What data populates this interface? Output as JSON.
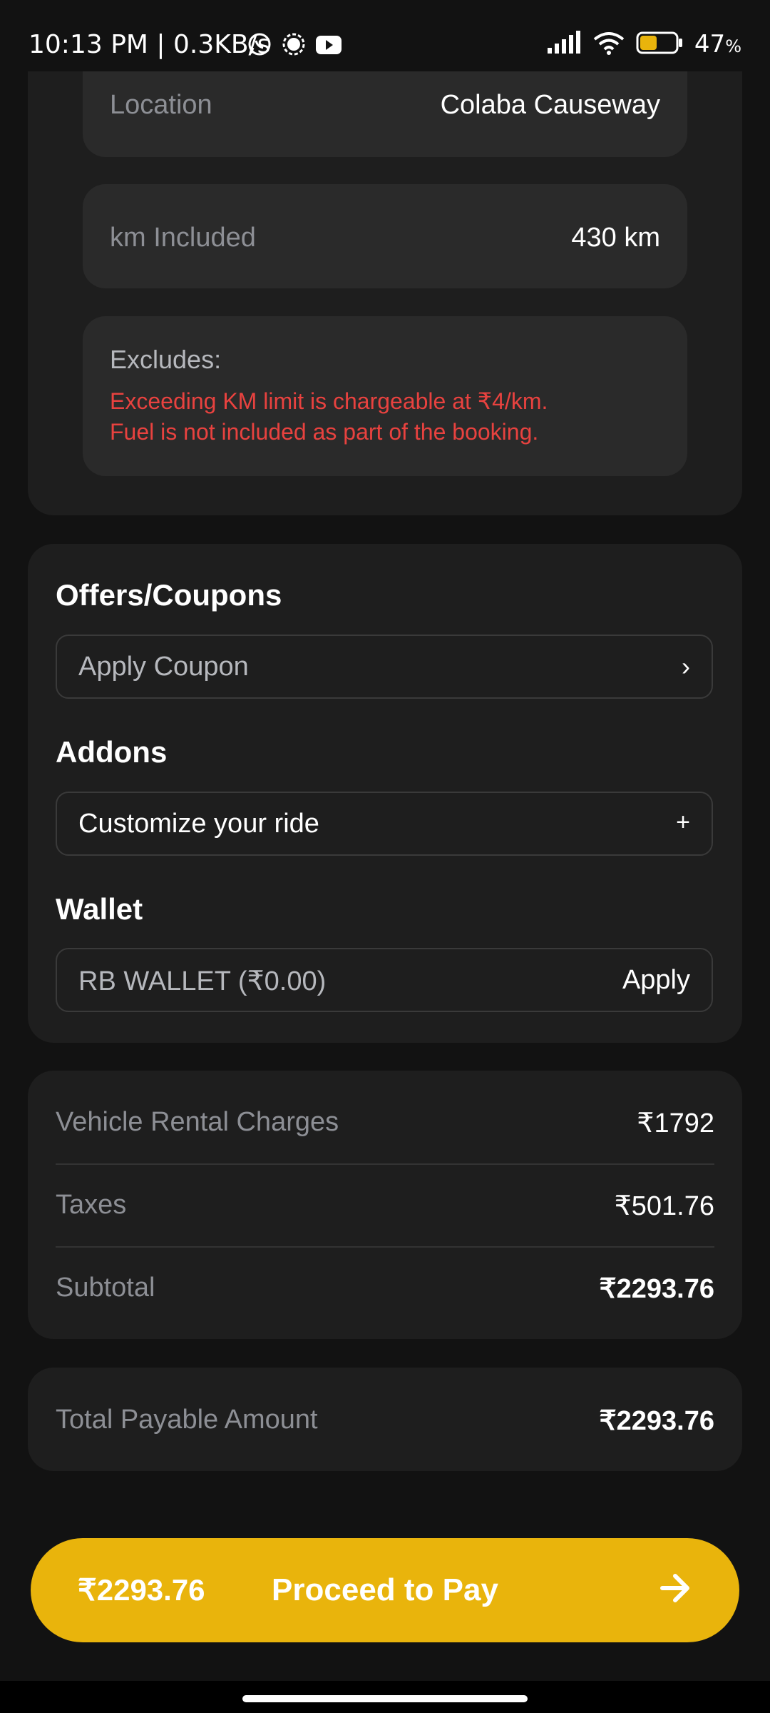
{
  "status_bar": {
    "time_speed": "10:13 PM | 0.3KB/s",
    "battery_percent": "47",
    "battery_unit": "%",
    "battery_level": 0.47,
    "icons": [
      "whatsapp-icon",
      "signal-app-icon",
      "youtube-icon",
      "cellular-signal-icon",
      "wifi-icon",
      "battery-icon"
    ]
  },
  "booking": {
    "location_label": "Location",
    "location_value": "Colaba Causeway",
    "km_label": "km Included",
    "km_value": "430 km",
    "excludes_title": "Excludes:",
    "excludes_lines": [
      "Exceeding KM limit is chargeable at ₹4/km.",
      "Fuel is not included as part of the booking."
    ]
  },
  "offers": {
    "title": "Offers/Coupons",
    "coupon_label": "Apply Coupon",
    "coupon_chevron": "›"
  },
  "addons": {
    "title": "Addons",
    "customize_label": "Customize your ride",
    "customize_plus": "+"
  },
  "wallet": {
    "title": "Wallet",
    "wallet_label": "RB WALLET (₹0.00)",
    "apply_label": "Apply"
  },
  "charges": {
    "rows": [
      {
        "label": "Vehicle Rental Charges",
        "value": "₹1792"
      },
      {
        "label": "Taxes",
        "value": "₹501.76"
      },
      {
        "label": "Subtotal",
        "value": "₹2293.76"
      }
    ]
  },
  "total": {
    "label": "Total Payable Amount",
    "value": "₹2293.76"
  },
  "pay_button": {
    "amount": "₹2293.76",
    "label": "Proceed to Pay"
  },
  "colors": {
    "accent": "#e9b40c",
    "warning_text": "#e8423f",
    "background": "#121212",
    "card": "#1e1e1e"
  }
}
